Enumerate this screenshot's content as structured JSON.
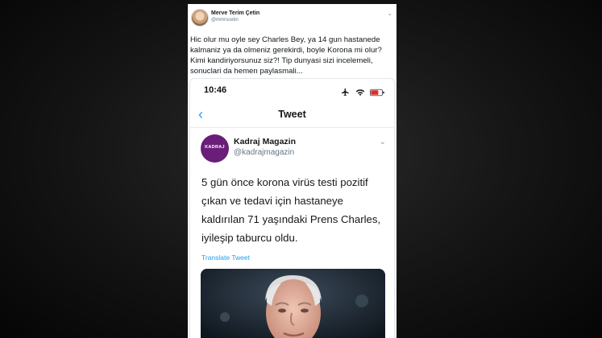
{
  "outer_tweet": {
    "name": "Merve Terim Çetin",
    "handle": "@mmrscetin",
    "text_lines": [
      "Hic olur mu oyle sey Charles Bey, ya 14 gun hastanede",
      "kalmaniz ya da olmeniz gerekirdi, boyle Korona mi olur?",
      "Kimi kandiriyorsunuz siz?! Tip dunyasi sizi incelemeli,",
      "sonuclari da hemen paylasmali..."
    ]
  },
  "phone": {
    "status_time": "10:46",
    "nav_title": "Tweet"
  },
  "inner_tweet": {
    "avatar_text": "KADRAJ",
    "name": "Kadraj Magazin",
    "handle": "@kadrajmagazin",
    "text_lines": [
      "5 gün önce korona virüs testi pozitif",
      "çıkan ve tedavi için hastaneye",
      "kaldırılan 71 yaşındaki Prens Charles,",
      "iyileşip taburcu oldu."
    ],
    "translate_label": "Translate Tweet"
  },
  "colors": {
    "link_blue": "#1da1f2",
    "brand_purple": "#6b1d7a"
  }
}
